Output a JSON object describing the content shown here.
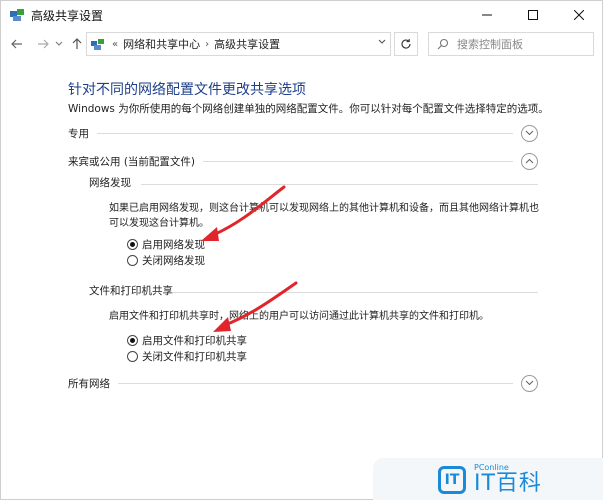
{
  "window": {
    "title": "高级共享设置",
    "controls": {
      "minimize": "minimize",
      "maximize": "maximize",
      "close": "close"
    }
  },
  "nav": {
    "breadcrumb_prefix": "«",
    "breadcrumb": [
      "网络和共享中心",
      "高级共享设置"
    ],
    "breadcrumb_sep": "›",
    "dropdown": "⌄",
    "search_placeholder": "搜索控制面板"
  },
  "main": {
    "heading": "针对不同的网络配置文件更改共享选项",
    "intro": "Windows 为你所使用的每个网络创建单独的网络配置文件。你可以针对每个配置文件选择特定的选项。",
    "sections": {
      "private": "专用",
      "guest_public": "来宾或公用 (当前配置文件)",
      "all_networks": "所有网络"
    },
    "network_discovery": {
      "title": "网络发现",
      "description": "如果已启用网络发现，则这台计算机可以发现网络上的其他计算机和设备，而且其他网络计算机也可以发现这台计算机。",
      "options": [
        {
          "label": "启用网络发现",
          "selected": true
        },
        {
          "label": "关闭网络发现",
          "selected": false
        }
      ]
    },
    "file_printer_sharing": {
      "title": "文件和打印机共享",
      "description": "启用文件和打印机共享时，网络上的用户可以访问通过此计算机共享的文件和打印机。",
      "options": [
        {
          "label": "启用文件和打印机共享",
          "selected": true
        },
        {
          "label": "关闭文件和打印机共享",
          "selected": false
        }
      ]
    }
  },
  "watermark": {
    "logo_letter": "IT",
    "small": "PConline",
    "big": "IT百科"
  },
  "colors": {
    "heading": "#1e3f8a",
    "arrow": "#e0262a",
    "watermark": "#1a8ad8"
  }
}
